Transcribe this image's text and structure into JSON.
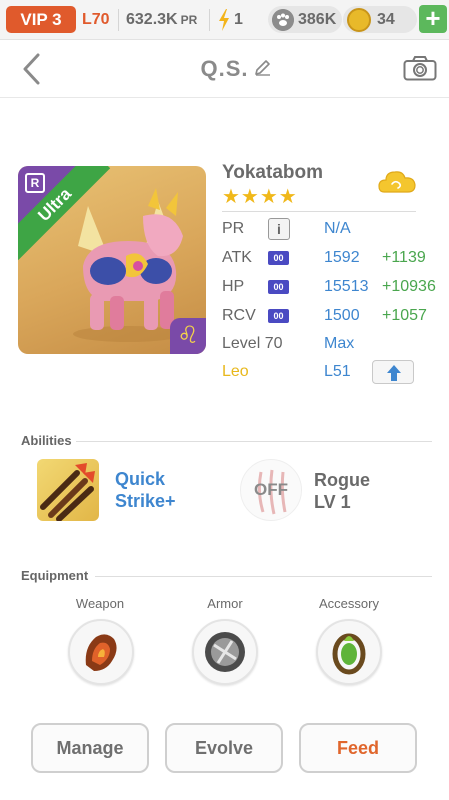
{
  "status_bar": {
    "vip_label": "VIP 3",
    "level": "L70",
    "power_rating": "632.3K",
    "power_rating_unit": "PR",
    "energy": "1",
    "paw_currency": "386K",
    "coins": "34",
    "add_label": "+"
  },
  "header": {
    "title": "Q.S.",
    "icons": [
      "back-arrow-icon",
      "pencil-icon",
      "camera-icon"
    ]
  },
  "monster": {
    "name": "Yokatabom",
    "stars": "★★★★",
    "rarity": "Ultra",
    "rank_badge": "R",
    "zodiac_glyph": "♌",
    "stats": {
      "pr": {
        "label": "PR",
        "info": "i",
        "value": "N/A"
      },
      "atk": {
        "label": "ATK",
        "chip": "00",
        "value": "1592",
        "bonus": "+1139"
      },
      "hp": {
        "label": "HP",
        "chip": "00",
        "value": "15513",
        "bonus": "+10936"
      },
      "rcv": {
        "label": "RCV",
        "chip": "00",
        "value": "1500",
        "bonus": "+1057"
      },
      "level": {
        "label": "Level 70",
        "value": "Max"
      },
      "zodiac": {
        "label": "Leo",
        "value": "L51"
      }
    },
    "colors": {
      "value": "#3e86cf",
      "bonus": "#4aa64e",
      "zodiac": "#e8b81c",
      "rarity_ribbon": "#3ea545"
    }
  },
  "abilities": {
    "section_title": "Abilities",
    "primary": {
      "line1": "Quick",
      "line2": "Strike+"
    },
    "secondary": {
      "status": "OFF",
      "line1": "Rogue",
      "line2": "LV 1"
    }
  },
  "equipment": {
    "section_title": "Equipment",
    "slots": [
      {
        "label": "Weapon"
      },
      {
        "label": "Armor"
      },
      {
        "label": "Accessory"
      }
    ]
  },
  "actions": {
    "manage": "Manage",
    "evolve": "Evolve",
    "feed": "Feed"
  }
}
